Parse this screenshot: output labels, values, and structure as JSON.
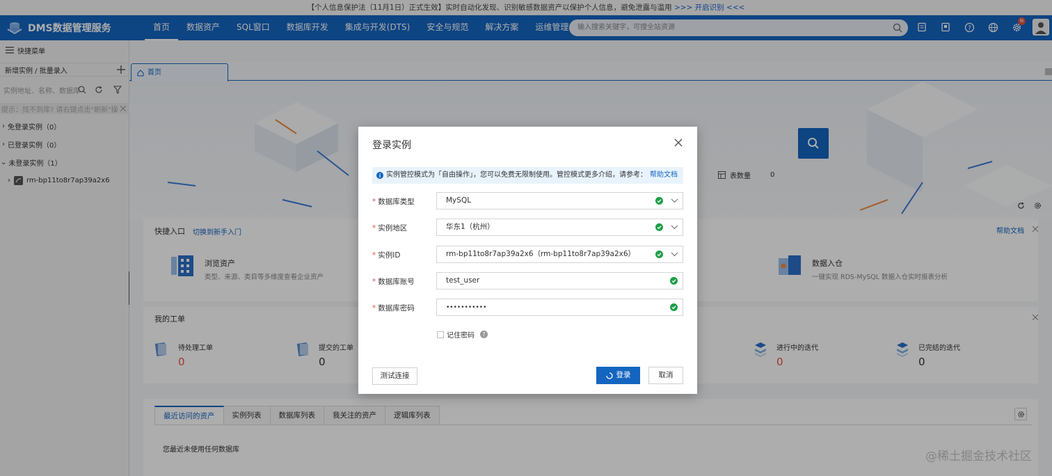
{
  "notice": {
    "text": "【个人信息保护法（11月1日）正式生效】实时自动化发现、识别敏感数据资产以保护个人信息，避免泄露与滥用",
    "link": ">>> 开启识别 <<<"
  },
  "header": {
    "brand": "DMS数据管理服务",
    "nav": [
      "首页",
      "数据资产",
      "SQL窗口",
      "数据库开发",
      "集成与开发(DTS)",
      "安全与规范",
      "解决方案",
      "运维管理"
    ],
    "search_placeholder": "输入搜索关键字，可搜全站资源",
    "badge": "N"
  },
  "sidebar": {
    "quick_menu": "快捷菜单",
    "add_instance": "新增实例 / 批量录入",
    "filter_placeholder": "实例地址、名称、数据库",
    "tip": "提示：找不到库? 请右键点击\"刷新\"操作",
    "groups": [
      "免登录实例（0）",
      "已登录实例（0）",
      "未登录实例（1）"
    ],
    "instance": "rm-bp11to8r7ap39a2x6"
  },
  "tabs": {
    "home": "首页"
  },
  "main": {
    "table_count_label": "表数量",
    "table_count": "0",
    "quick_entry": "快捷入口",
    "switch_newbie": "切换到新手入门",
    "help_doc": "帮助文档",
    "browse_assets": "浏览资产",
    "browse_assets_desc": "类型、来源、类目等多维度查看企业资产",
    "data_warehouse": "数据入仓",
    "data_warehouse_desc": "一键实现 RDS-MySQL 数据入仓实时报表分析",
    "my_tickets": "我的工单",
    "tickets": [
      {
        "label": "待处理工单",
        "value": "0"
      },
      {
        "label": "提交的工单",
        "value": "0"
      },
      {
        "label": "进行中的迭代",
        "value": "0"
      },
      {
        "label": "已完结的迭代",
        "value": "0"
      }
    ],
    "asset_tabs": [
      "最近访问的资产",
      "实例列表",
      "数据库列表",
      "我关注的资产",
      "逻辑库列表"
    ],
    "empty_text": "您最近未使用任何数据库"
  },
  "modal": {
    "title": "登录实例",
    "info_text": "实例管控模式为「自由操作」，您可以免费无限制使用。管控模式更多介绍，请参考：",
    "info_link": "帮助文档",
    "fields": [
      {
        "label": "数据库类型",
        "value": "MySQL"
      },
      {
        "label": "实例地区",
        "value": "华东1（杭州）"
      },
      {
        "label": "实例ID",
        "value": "rm-bp11to8r7ap39a2x6（rm-bp11to8r7ap39a2x6）"
      },
      {
        "label": "数据库账号",
        "value": "test_user"
      },
      {
        "label": "数据库密码",
        "value": "•••••••••••"
      }
    ],
    "remember": "记住密码",
    "test_button": "测试连接",
    "login_button": "登录",
    "cancel_button": "取消"
  },
  "watermark": "@稀土掘金技术社区",
  "colors": {
    "brand": "#1465c0",
    "success": "#1f9e48",
    "danger": "#e5533f"
  }
}
